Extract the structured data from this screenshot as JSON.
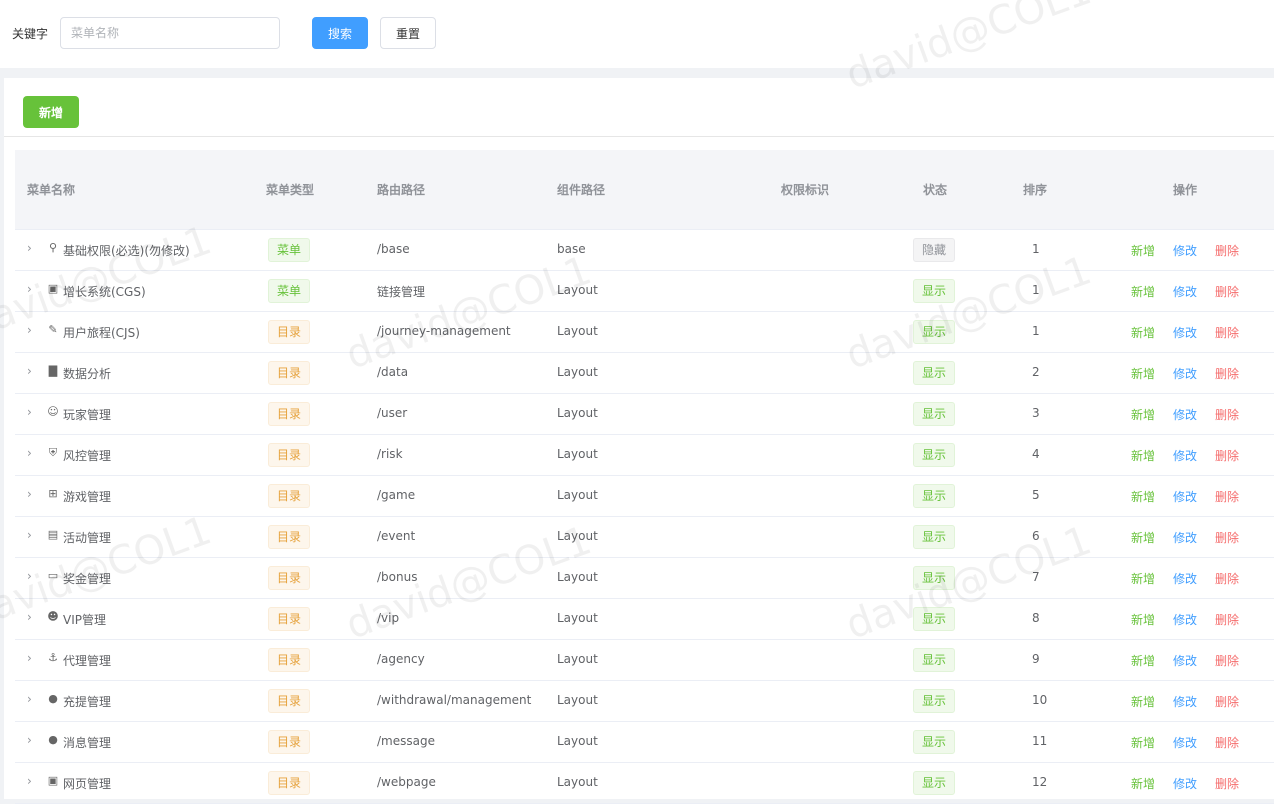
{
  "search": {
    "label": "关键字",
    "placeholder": "菜单名称",
    "search_button": "搜索",
    "reset_button": "重置"
  },
  "toolbar": {
    "add_button": "新增"
  },
  "table": {
    "columns": [
      "菜单名称",
      "菜单类型",
      "路由路径",
      "组件路径",
      "权限标识",
      "状态",
      "排序",
      "操作"
    ],
    "rows": [
      {
        "icon": "key-icon",
        "name": "基础权限(必选)(勿修改)",
        "type": "菜单",
        "route": "/base",
        "component": "base",
        "status": "隐藏",
        "sort": "1"
      },
      {
        "icon": "image-icon",
        "name": "增长系统(CGS)",
        "type": "菜单",
        "route": "链接管理",
        "component": "Layout",
        "status": "显示",
        "sort": "1"
      },
      {
        "icon": "edit-icon",
        "name": "用户旅程(CJS)",
        "type": "目录",
        "route": "/journey-management",
        "component": "Layout",
        "status": "显示",
        "sort": "1"
      },
      {
        "icon": "bar-chart-icon",
        "name": "数据分析",
        "type": "目录",
        "route": "/data",
        "component": "Layout",
        "status": "显示",
        "sort": "2"
      },
      {
        "icon": "user-icon",
        "name": "玩家管理",
        "type": "目录",
        "route": "/user",
        "component": "Layout",
        "status": "显示",
        "sort": "3"
      },
      {
        "icon": "shield-icon",
        "name": "风控管理",
        "type": "目录",
        "route": "/risk",
        "component": "Layout",
        "status": "显示",
        "sort": "4"
      },
      {
        "icon": "grid-icon",
        "name": "游戏管理",
        "type": "目录",
        "route": "/game",
        "component": "Layout",
        "status": "显示",
        "sort": "5"
      },
      {
        "icon": "calendar-icon",
        "name": "活动管理",
        "type": "目录",
        "route": "/event",
        "component": "Layout",
        "status": "显示",
        "sort": "6"
      },
      {
        "icon": "ticket-icon",
        "name": "奖金管理",
        "type": "目录",
        "route": "/bonus",
        "component": "Layout",
        "status": "显示",
        "sort": "7"
      },
      {
        "icon": "users-icon",
        "name": "VIP管理",
        "type": "目录",
        "route": "/vip",
        "component": "Layout",
        "status": "显示",
        "sort": "8"
      },
      {
        "icon": "link-icon",
        "name": "代理管理",
        "type": "目录",
        "route": "/agency",
        "component": "Layout",
        "status": "显示",
        "sort": "9"
      },
      {
        "icon": "money-bag-icon",
        "name": "充提管理",
        "type": "目录",
        "route": "/withdrawal/management",
        "component": "Layout",
        "status": "显示",
        "sort": "10"
      },
      {
        "icon": "message-icon",
        "name": "消息管理",
        "type": "目录",
        "route": "/message",
        "component": "Layout",
        "status": "显示",
        "sort": "11"
      },
      {
        "icon": "webpage-icon",
        "name": "网页管理",
        "type": "目录",
        "route": "/webpage",
        "component": "Layout",
        "status": "显示",
        "sort": "12"
      }
    ],
    "ops": {
      "add": "新增",
      "edit": "修改",
      "delete": "删除"
    }
  },
  "watermark": "david@COL1"
}
